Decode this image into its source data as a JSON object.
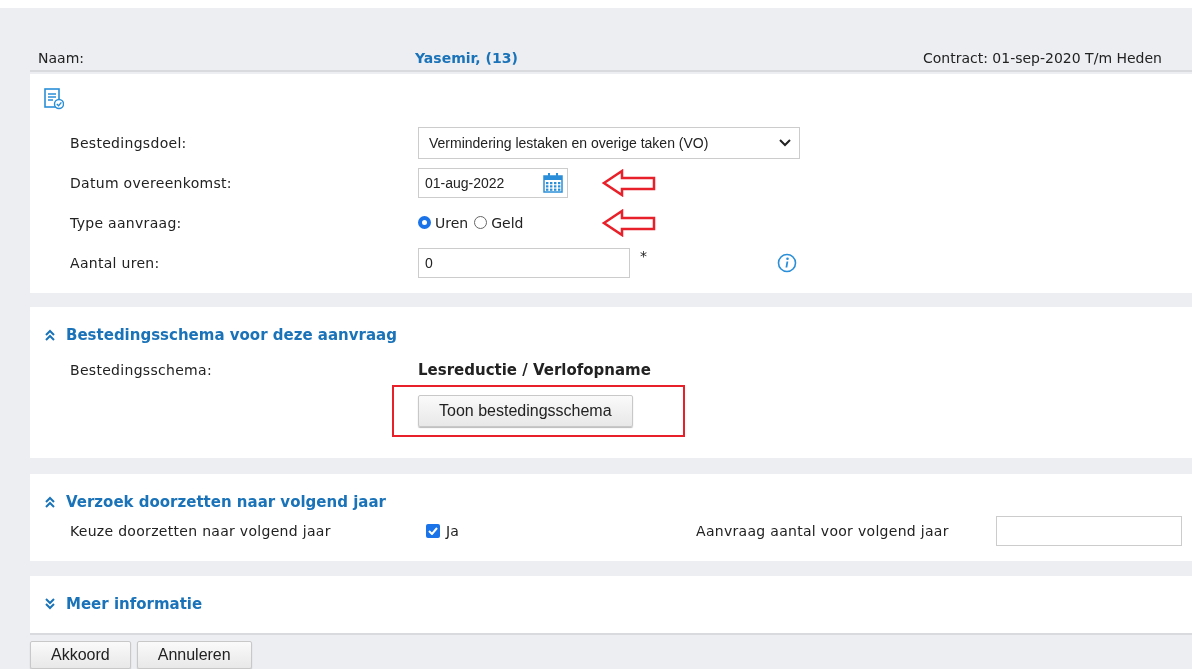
{
  "header": {
    "name_label": "Naam:",
    "name_value": "Yasemir, (13)",
    "contract": "Contract: 01-sep-2020 T/m Heden"
  },
  "form": {
    "rows": [
      {
        "kind": "select",
        "label": "Bestedingsdoel:",
        "value": "Vermindering lestaken en overige taken (VO)",
        "highlighted": false
      },
      {
        "kind": "date",
        "label": "Datum overeenkomst:",
        "value": "01-aug-2022",
        "highlighted": true
      },
      {
        "kind": "radio",
        "label": "Type aanvraag:",
        "options": [
          {
            "label": "Uren",
            "selected": true
          },
          {
            "label": "Geld",
            "selected": false
          }
        ],
        "highlighted": true
      },
      {
        "kind": "number",
        "label": "Aantal uren:",
        "value": "0",
        "required_mark": "*",
        "info": true,
        "highlighted": false
      }
    ]
  },
  "sections": [
    {
      "title": "Bestedingsschema voor deze aanvraag",
      "expanded": true,
      "kind": "schema",
      "label": "Bestedingsschema:",
      "value": "Lesreductie / Verlofopname",
      "button": "Toon bestedingsschema",
      "highlighted": true
    },
    {
      "title": "Verzoek doorzetten naar volgend jaar",
      "expanded": true,
      "kind": "carry",
      "label": "Keuze doorzetten naar volgend jaar",
      "checkbox": {
        "label": "Ja",
        "checked": true
      },
      "amount_label": "Aanvraag aantal voor volgend jaar"
    },
    {
      "title": "Meer informatie",
      "expanded": false
    }
  ],
  "buttons": [
    "Akkoord",
    "Annuleren"
  ]
}
